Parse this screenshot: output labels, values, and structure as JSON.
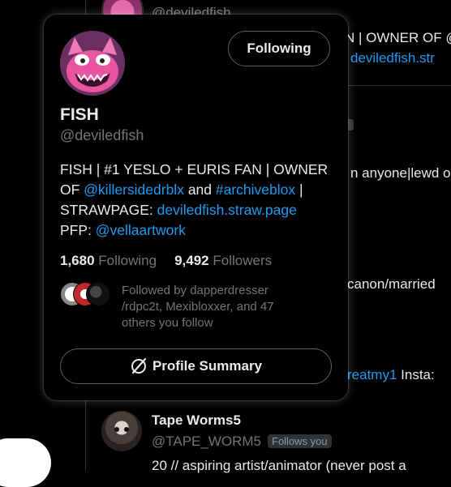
{
  "background": {
    "top_handle": "@deviledfish",
    "top_bio_fragment": "N | OWNER OF @",
    "top_link_fragment": "deviledfish.str",
    "mid_text_1": "n anyone|lewd o",
    "mid_text_2": "canon/married",
    "mid_link": "reatmy1",
    "mid_insta": "Insta:",
    "tape_worms": {
      "name": "Tape Worms5",
      "handle": "@TAPE_WORM5",
      "badge": "Follows you",
      "bio": "20 // aspiring artist/animator (never post a"
    }
  },
  "card": {
    "name": "FISH",
    "handle": "@deviledfish",
    "follow_button": "Following",
    "bio": {
      "p1": "FISH | #1 YESLO + EURIS FAN | OWNER OF ",
      "link1": "@killersidedrblx",
      "p2": " and ",
      "link2": "#archiveblox",
      "p3": " | STRAWPAGE: ",
      "link3": "deviledfish.straw.page",
      "p4": " PFP: ",
      "link4": "@vellaartwork"
    },
    "following_count": "1,680",
    "following_label": "Following",
    "followers_count": "9,492",
    "followers_label": "Followers",
    "followed_by": "Followed by dapperdresser /rdpc2t, Mexibloxxer, and 47 others you follow",
    "summary_button": "Profile Summary"
  },
  "colors": {
    "link": "#1d9bf0",
    "muted": "#71767b",
    "text": "#e7e9ea",
    "border": "#536471"
  }
}
